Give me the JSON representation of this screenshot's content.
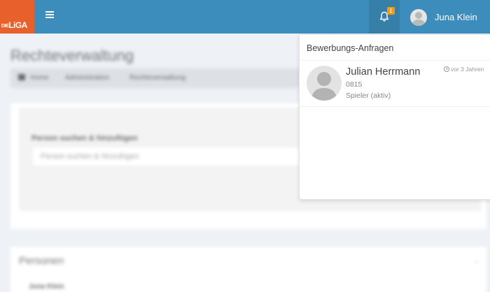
{
  "brand": {
    "logo_small": "DIE",
    "logo_main": "LiGA"
  },
  "header": {
    "notification_count": "1",
    "user_name": "Juna Klein"
  },
  "page": {
    "title": "Rechteverwaltung",
    "breadcrumb": [
      "Home",
      "Administration",
      "Rechteverwaltung"
    ],
    "search_label": "Person suchen & hinzufügen",
    "search_placeholder": "Person suchen & hinzufügen",
    "persons_title": "Personen",
    "persons_first": "Juna Klein"
  },
  "notifications": {
    "title": "Bewerbungs-Anfragen",
    "items": [
      {
        "name": "Julian Herrmann",
        "code": "0815",
        "role": "Spieler (aktiv)",
        "time": "vor 3 Jahren"
      }
    ]
  },
  "colors": {
    "header": "#3c8dbc",
    "header_active": "#367fa9",
    "logo": "#e8612c",
    "badge": "#f39c12"
  },
  "icons": [
    "hamburger-icon",
    "bell-icon",
    "user-avatar-icon",
    "clock-icon",
    "home-icon",
    "chevron-down-icon"
  ]
}
